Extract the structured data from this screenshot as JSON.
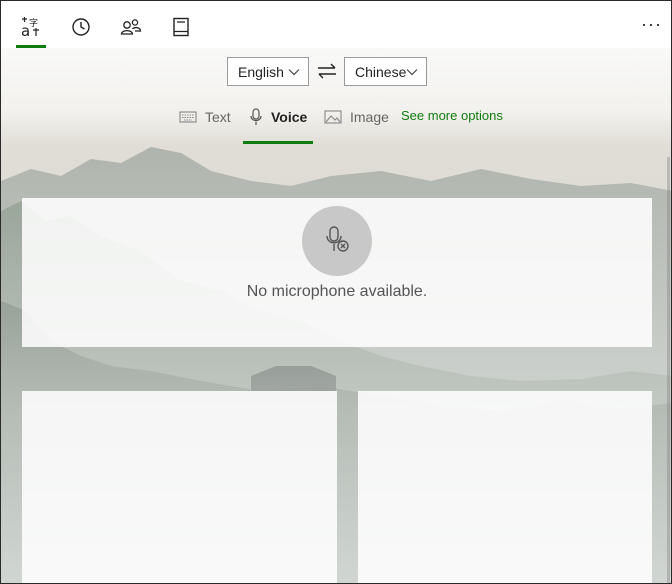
{
  "nav": {
    "items": [
      {
        "name": "translate",
        "icon": "translate-icon",
        "active": true
      },
      {
        "name": "history",
        "icon": "clock-icon",
        "active": false
      },
      {
        "name": "conversation",
        "icon": "people-icon",
        "active": false
      },
      {
        "name": "phrasebook",
        "icon": "book-icon",
        "active": false
      }
    ],
    "more_label": "···"
  },
  "languages": {
    "from": "English",
    "to": "Chinese",
    "swap_icon": "swap-arrows-icon"
  },
  "modes": {
    "text": "Text",
    "voice": "Voice",
    "image": "Image",
    "active": "voice",
    "see_more": "See more options"
  },
  "voice": {
    "status": "No microphone available.",
    "icon": "microphone-unavailable-icon"
  },
  "colors": {
    "accent": "#107c10"
  }
}
